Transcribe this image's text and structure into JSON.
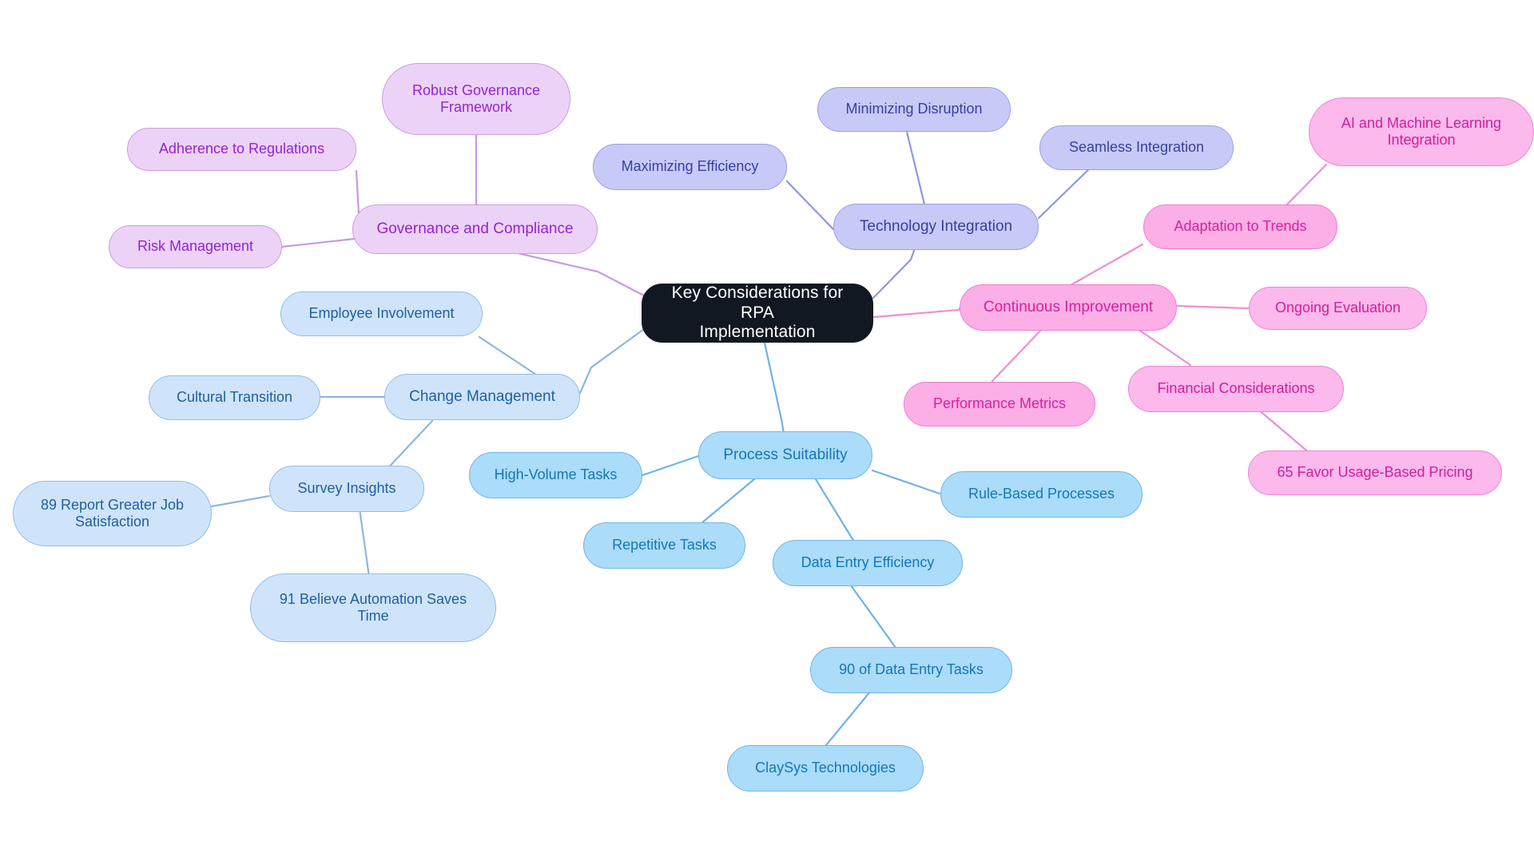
{
  "diagram": {
    "title": "Key Considerations for RPA Implementation",
    "type": "mindmap",
    "background": "#ffffff",
    "root": {
      "label": "Key Considerations for RPA\nImplementation"
    },
    "palette": {
      "purple": {
        "fill": "#edd2f8",
        "stroke": "#c99ede",
        "text": "#9125cf"
      },
      "periwinkle": {
        "fill": "#c7caf7",
        "stroke": "#9aa0e2",
        "text": "#3a3f9e"
      },
      "pink": {
        "fill": "#fcaee6",
        "stroke": "#ef7fce",
        "text": "#d6219f"
      },
      "pinklight": {
        "fill": "#fbb9ec",
        "stroke": "#ef86d4",
        "text": "#cf1f9a"
      },
      "sky": {
        "fill": "#abdcfa",
        "stroke": "#72b6e3",
        "text": "#1577b5"
      },
      "paleblue": {
        "fill": "#cfe4fb",
        "stroke": "#93bde4",
        "text": "#1f5f9e"
      },
      "root": {
        "fill": "#111822",
        "stroke": "#111822",
        "text": "#ffffff"
      }
    },
    "branches": [
      {
        "id": "governance",
        "label": "Governance and Compliance",
        "family": "purple",
        "children": [
          {
            "id": "robust-governance-framework",
            "label": "Robust Governance\nFramework"
          },
          {
            "id": "adherence-to-regulations",
            "label": "Adherence to Regulations"
          },
          {
            "id": "risk-management",
            "label": "Risk Management"
          }
        ]
      },
      {
        "id": "technology-integration",
        "label": "Technology Integration",
        "family": "periwinkle",
        "children": [
          {
            "id": "minimizing-disruption",
            "label": "Minimizing Disruption"
          },
          {
            "id": "maximizing-efficiency",
            "label": "Maximizing Efficiency"
          },
          {
            "id": "seamless-integration",
            "label": "Seamless Integration"
          }
        ]
      },
      {
        "id": "continuous-improvement",
        "label": "Continuous Improvement",
        "family": "pink",
        "children": [
          {
            "id": "adaptation-to-trends",
            "label": "Adaptation to Trends"
          },
          {
            "id": "ai-and-machine-learning-integration",
            "label": "AI and Machine Learning\nIntegration"
          },
          {
            "id": "ongoing-evaluation",
            "label": "Ongoing Evaluation"
          },
          {
            "id": "performance-metrics",
            "label": "Performance Metrics"
          },
          {
            "id": "financial-considerations",
            "label": "Financial Considerations"
          },
          {
            "id": "favor-usage-based-pricing",
            "label": "65 Favor Usage-Based Pricing"
          }
        ]
      },
      {
        "id": "change-management",
        "label": "Change Management",
        "family": "paleblue",
        "children": [
          {
            "id": "employee-involvement",
            "label": "Employee Involvement"
          },
          {
            "id": "cultural-transition",
            "label": "Cultural Transition"
          },
          {
            "id": "survey-insights",
            "label": "Survey Insights"
          },
          {
            "id": "report-greater-job-satisfaction",
            "label": "89 Report Greater Job\nSatisfaction"
          },
          {
            "id": "believe-automation-saves-time",
            "label": "91 Believe Automation Saves\nTime"
          }
        ]
      },
      {
        "id": "process-suitability",
        "label": "Process Suitability",
        "family": "sky",
        "children": [
          {
            "id": "high-volume-tasks",
            "label": "High-Volume Tasks"
          },
          {
            "id": "repetitive-tasks",
            "label": "Repetitive Tasks"
          },
          {
            "id": "rule-based-processes",
            "label": "Rule-Based Processes"
          },
          {
            "id": "data-entry-efficiency",
            "label": "Data Entry Efficiency"
          },
          {
            "id": "of-data-entry-tasks",
            "label": "90 of Data Entry Tasks"
          },
          {
            "id": "claysys-technologies",
            "label": "ClaySys Technologies"
          }
        ]
      }
    ]
  }
}
